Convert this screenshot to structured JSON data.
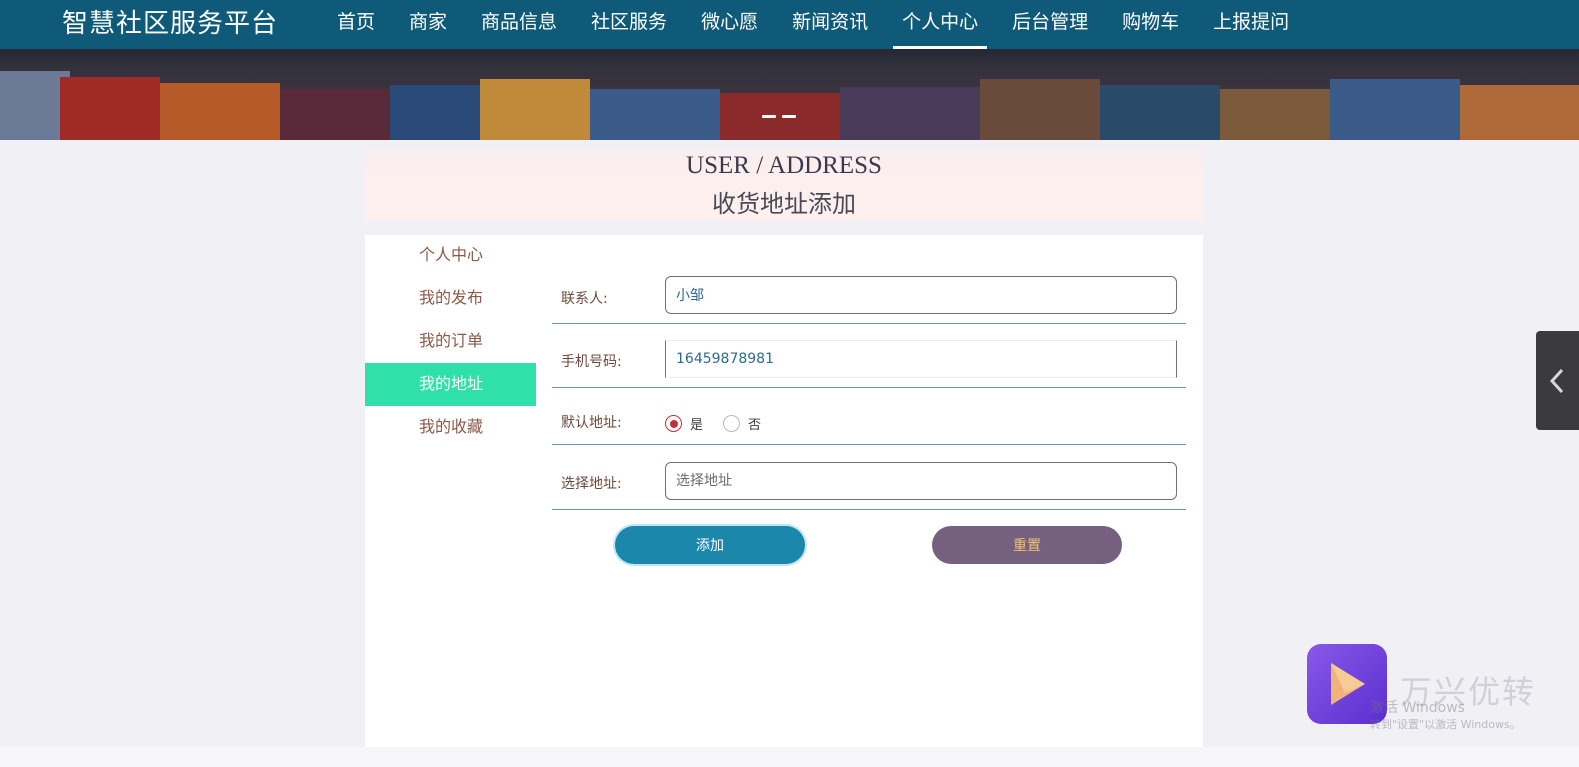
{
  "header": {
    "brand": "智慧社区服务平台",
    "nav": [
      {
        "label": "首页"
      },
      {
        "label": "商家"
      },
      {
        "label": "商品信息"
      },
      {
        "label": "社区服务"
      },
      {
        "label": "微心愿"
      },
      {
        "label": "新闻资讯"
      },
      {
        "label": "个人中心",
        "active": true
      },
      {
        "label": "后台管理"
      },
      {
        "label": "购物车"
      },
      {
        "label": "上报提问"
      }
    ],
    "accent": "#0e5a78"
  },
  "banner": {
    "carousel_dots": 2
  },
  "title": {
    "en": "USER / ADDRESS",
    "cn": "收货地址添加"
  },
  "sidebar": {
    "items": [
      {
        "label": "个人中心"
      },
      {
        "label": "我的发布"
      },
      {
        "label": "我的订单"
      },
      {
        "label": "我的地址",
        "active": true
      },
      {
        "label": "我的收藏"
      }
    ],
    "active_color": "#2fe0a8"
  },
  "form": {
    "contact": {
      "label": "联系人:",
      "value": "小邹"
    },
    "phone": {
      "label": "手机号码:",
      "value": "16459878981"
    },
    "default": {
      "label": "默认地址:",
      "options": [
        "是",
        "否"
      ],
      "selected": "是"
    },
    "address": {
      "label": "选择地址:",
      "placeholder": "选择地址"
    },
    "add_button": "添加",
    "reset_button": "重置"
  },
  "watermark": {
    "brand": "万兴优转",
    "activate": "激活 Windows",
    "activate_sub": "转到\"设置\"以激活 Windows。"
  }
}
